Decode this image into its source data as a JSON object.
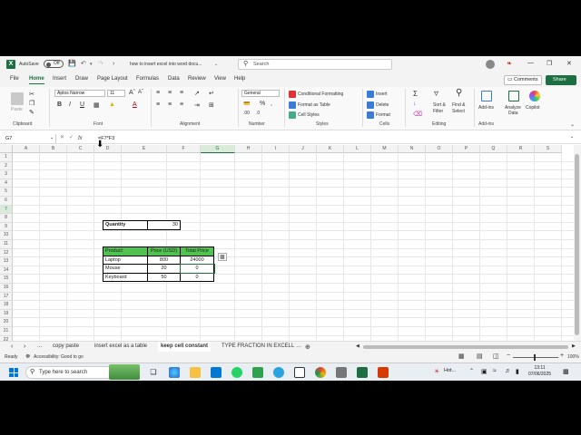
{
  "titlebar": {
    "autosave_label": "AutoSave",
    "autosave_state": "Off",
    "doc_title": "how to insert excel into word docu...",
    "search_placeholder": "Search"
  },
  "ribbon_tabs": [
    "File",
    "Home",
    "Insert",
    "Draw",
    "Page Layout",
    "Formulas",
    "Data",
    "Review",
    "View",
    "Help"
  ],
  "active_tab": "Home",
  "actions": {
    "comments": "Comments",
    "share": "Share"
  },
  "ribbon": {
    "font_name": "Aptos Narrow",
    "font_size": "11",
    "number_format": "General",
    "styles": {
      "conditional": "Conditional Formatting",
      "format_table": "Format as Table",
      "cell_styles": "Cell Styles"
    },
    "cells": {
      "insert": "Insert",
      "delete": "Delete",
      "format": "Format"
    },
    "editing": {
      "sort": "Sort &",
      "filter": "Filter",
      "find": "Find &",
      "select": "Select"
    },
    "addins": {
      "addins": "Add-ins",
      "analyze": "Analyze",
      "analyze2": "Data",
      "copilot": "Copilot"
    },
    "groups": {
      "clipboard": "Clipboard",
      "font": "Font",
      "alignment": "Alignment",
      "number": "Number",
      "styles": "Styles",
      "cells": "Cells",
      "editing": "Editing",
      "addins": "Add-ins"
    },
    "paste_label": "Paste",
    "bold": "B",
    "italic": "I",
    "underline": "U"
  },
  "formula_bar": {
    "name_box": "G7",
    "fx": "fx",
    "formula": "=F7*F3"
  },
  "columns": [
    "A",
    "B",
    "C",
    "D",
    "E",
    "F",
    "G",
    "H",
    "I",
    "J",
    "K",
    "L",
    "M",
    "N",
    "O",
    "P",
    "Q",
    "R",
    "S"
  ],
  "rows": [
    "1",
    "2",
    "3",
    "4",
    "5",
    "6",
    "7",
    "8",
    "9",
    "10",
    "11",
    "12",
    "13",
    "14",
    "15",
    "16",
    "17",
    "18",
    "19",
    "20",
    "21",
    "22"
  ],
  "selected_cell": {
    "col": "G",
    "row": "7"
  },
  "sheet": {
    "quantity_label": "Quantity",
    "quantity_value": "30",
    "table_headers": [
      "Product",
      "Price (USD)",
      "Total Price"
    ],
    "table_rows": [
      {
        "product": "Laptop",
        "price": "800",
        "total": "24000"
      },
      {
        "product": "Mouse",
        "price": "20",
        "total": "0"
      },
      {
        "product": "Keyboard",
        "price": "50",
        "total": "0"
      }
    ]
  },
  "sheet_tabs": [
    "...",
    "copy paste",
    "insert excel as a table",
    "keep cell constant",
    "TYPE FRACTION IN EXCELL"
  ],
  "active_sheet": "keep cell constant",
  "status": {
    "ready": "Ready",
    "accessibility": "Accessibility: Good to go",
    "zoom": "100%"
  },
  "taskbar": {
    "search_placeholder": "Type here to search",
    "weather": "Hot...",
    "time": "13:11",
    "date": "07/06/2025"
  }
}
